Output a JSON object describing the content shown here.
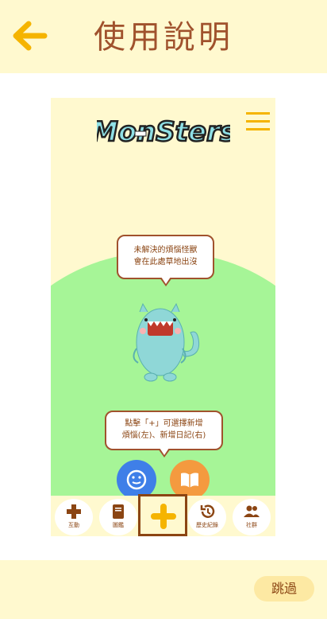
{
  "header": {
    "title": "使用說明",
    "back_icon": "arrow-left-icon",
    "accent_color": "#f5b400",
    "title_color": "#a0522d"
  },
  "preview": {
    "logo_text": "MonSters",
    "menu_icon": "hamburger-menu-icon",
    "bubble_top": {
      "line1": "未解決的煩惱怪獸",
      "line2": "會在此處草地出沒"
    },
    "bubble_bottom": {
      "line1": "點擊「+」可選擇新增",
      "line2": "煩惱(左)、新增日記(右)"
    },
    "fab_left_icon": "smiley-face-icon",
    "fab_right_icon": "open-book-icon",
    "nav": [
      {
        "label": "互動",
        "icon": "gamepad-icon"
      },
      {
        "label": "圖鑑",
        "icon": "book-icon"
      },
      {
        "label": "",
        "icon": "plus-icon"
      },
      {
        "label": "歷史紀錄",
        "icon": "history-icon"
      },
      {
        "label": "社群",
        "icon": "people-icon"
      }
    ]
  },
  "footer": {
    "skip_label": "跳過"
  }
}
